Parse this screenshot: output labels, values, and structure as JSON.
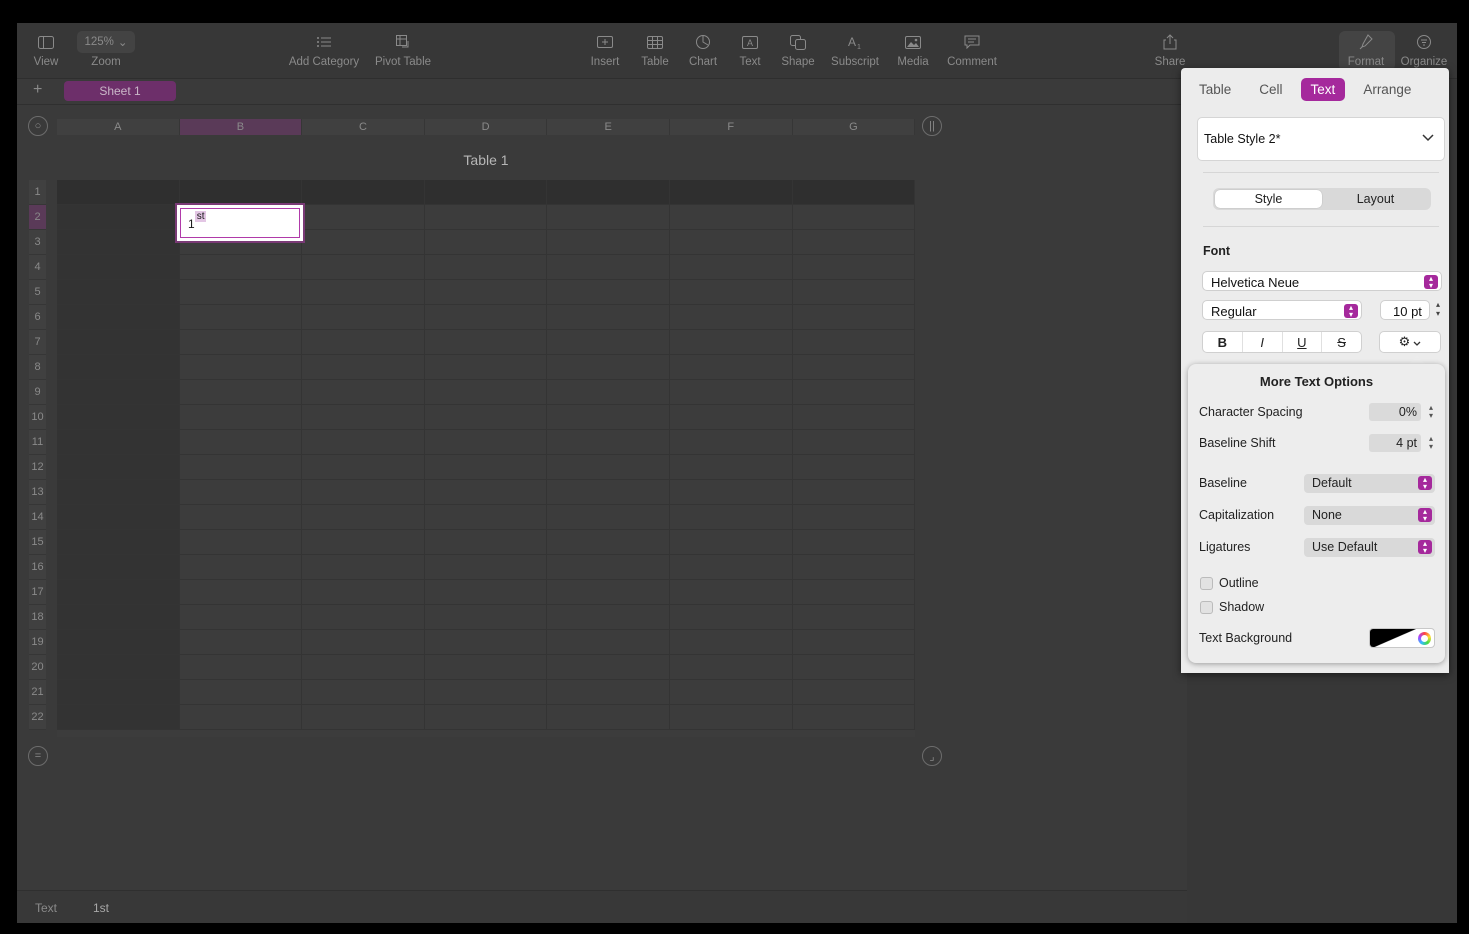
{
  "toolbar": {
    "view": "View",
    "zoom_value": "125%",
    "zoom": "Zoom",
    "add_category": "Add Category",
    "pivot_table": "Pivot Table",
    "insert": "Insert",
    "table": "Table",
    "chart": "Chart",
    "text": "Text",
    "shape": "Shape",
    "subscript": "Subscript",
    "media": "Media",
    "comment": "Comment",
    "share": "Share",
    "format": "Format",
    "organize": "Organize"
  },
  "sheet": {
    "tab": "Sheet 1"
  },
  "table": {
    "title": "Table 1",
    "columns": [
      "A",
      "B",
      "C",
      "D",
      "E",
      "F",
      "G"
    ],
    "rows": [
      "1",
      "2",
      "3",
      "4",
      "5",
      "6",
      "7",
      "8",
      "9",
      "10",
      "11",
      "12",
      "13",
      "14",
      "15",
      "16",
      "17",
      "18",
      "19",
      "20",
      "21",
      "22"
    ],
    "edit_base": "1",
    "edit_super": "st"
  },
  "statusbar": {
    "left": "Text",
    "value": "1st"
  },
  "inspector": {
    "tabs": [
      "Table",
      "Cell",
      "Text",
      "Arrange"
    ],
    "active_tab": "Text",
    "style_name": "Table Style 2*",
    "seg_style": "Style",
    "seg_layout": "Layout",
    "font_label": "Font",
    "font_family": "Helvetica Neue",
    "font_weight": "Regular",
    "font_size": "10 pt",
    "bold": "B",
    "italic": "I",
    "underline": "U",
    "strike": "S"
  },
  "popover": {
    "title": "More Text Options",
    "char_spacing_label": "Character Spacing",
    "char_spacing_value": "0%",
    "baseline_shift_label": "Baseline Shift",
    "baseline_shift_value": "4 pt",
    "baseline_label": "Baseline",
    "baseline_value": "Default",
    "capitalization_label": "Capitalization",
    "capitalization_value": "None",
    "ligatures_label": "Ligatures",
    "ligatures_value": "Use Default",
    "outline_label": "Outline",
    "shadow_label": "Shadow",
    "text_background_label": "Text Background"
  },
  "colors": {
    "accent": "#a5299c"
  }
}
